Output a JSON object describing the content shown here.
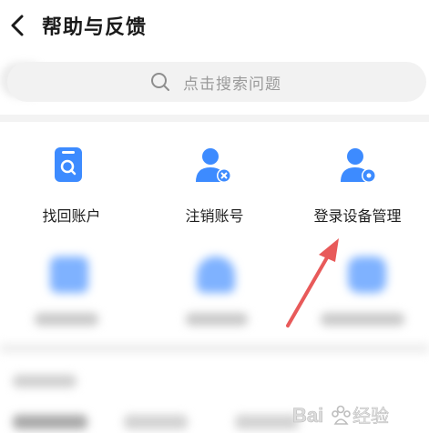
{
  "header": {
    "back_icon": "chevron-left-icon",
    "title": "帮助与反馈"
  },
  "search": {
    "icon": "search-icon",
    "placeholder": "点击搜索问题"
  },
  "quick_actions": [
    {
      "label": "找回账户",
      "icon": "find-account-icon"
    },
    {
      "label": "注销账号",
      "icon": "user-remove-icon"
    },
    {
      "label": "登录设备管理",
      "icon": "user-device-settings-icon"
    }
  ],
  "colors": {
    "accent": "#3d8bff",
    "annotation_arrow": "#e85a5a"
  },
  "watermark": {
    "text": "Bai du 经验"
  }
}
